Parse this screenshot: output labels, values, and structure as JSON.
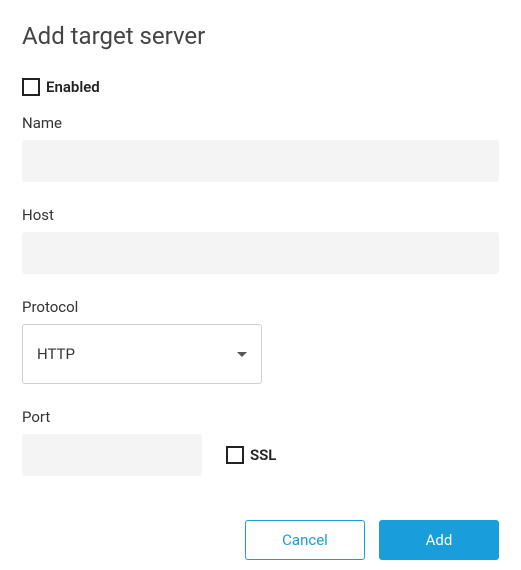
{
  "title": "Add target server",
  "enabled": {
    "label": "Enabled",
    "checked": false
  },
  "fields": {
    "name": {
      "label": "Name",
      "value": ""
    },
    "host": {
      "label": "Host",
      "value": ""
    },
    "protocol": {
      "label": "Protocol",
      "value": "HTTP"
    },
    "port": {
      "label": "Port",
      "value": ""
    },
    "ssl": {
      "label": "SSL",
      "checked": false
    }
  },
  "buttons": {
    "cancel": "Cancel",
    "add": "Add"
  }
}
